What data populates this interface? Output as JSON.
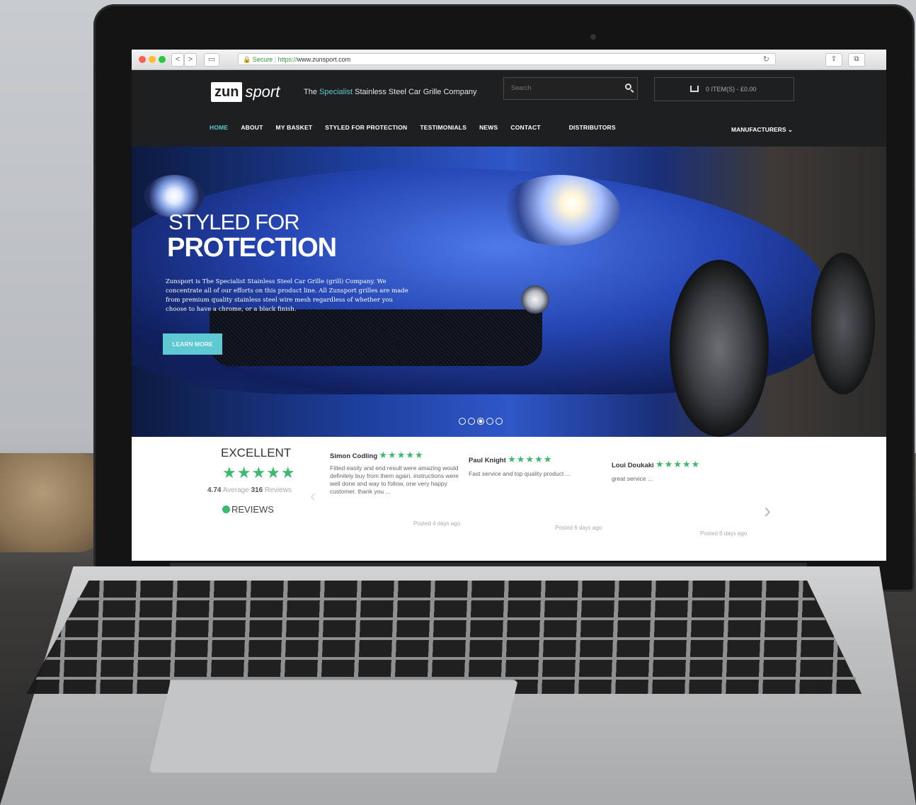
{
  "browser": {
    "secure_label": "Secure",
    "url_proto": "https://",
    "url_host": "www.zunsport.com",
    "back": "<",
    "forward": ">"
  },
  "header": {
    "logo_zun": "zun",
    "logo_sport": "sport",
    "tagline_pre": "The ",
    "tagline_accent": "Specialist",
    "tagline_post": " Stainless Steel Car Grille Company",
    "search_placeholder": "Search",
    "cart_label": "0 ITEM(S) - £0.00"
  },
  "nav": {
    "items": [
      "HOME",
      "ABOUT",
      "MY BASKET",
      "STYLED FOR PROTECTION",
      "TESTIMONIALS",
      "NEWS",
      "CONTACT",
      "DISTRIBUTORS"
    ],
    "manufacturers": "MANUFACTURERS"
  },
  "hero": {
    "title_line1": "STYLED FOR",
    "title_line2": "PROTECTION",
    "body": "Zunsport is The Specialist Stainless Steel Car Grille (grill) Company. We concentrate all of our efforts on this product line. All Zunsport grilles are made from premium quality stainless steel wire mesh regardless of whether you choose to have a chrome, or a black finish.",
    "button": "LEARN MORE",
    "slides": 5,
    "active_slide": 3
  },
  "reviews_summary": {
    "rating_word": "EXCELLENT",
    "stars": "★★★★★",
    "average": "4.74",
    "average_label": "Average",
    "count": "316",
    "count_label": "Reviews",
    "brand": "REVIEWS"
  },
  "reviews": [
    {
      "name": "Simon Codling",
      "stars": "★★★★★",
      "text": "Fitted easily and end result were amazing would definitely buy from them again. instructions were well done and way to follow, one very happy customer. thank you ...",
      "posted": "Posted 4 days ago"
    },
    {
      "name": "Paul Knight",
      "stars": "★★★★★",
      "text": "Fast service and top quality product ...",
      "posted": "Posted 6 days ago"
    },
    {
      "name": "Loui Doukaki",
      "stars": "★★★★★",
      "text": "great service ...",
      "posted": "Posted 6 days ago"
    }
  ],
  "colors": {
    "accent": "#5ec9d3",
    "star_green": "#3cb86f",
    "header_bg": "#1e1f20"
  }
}
